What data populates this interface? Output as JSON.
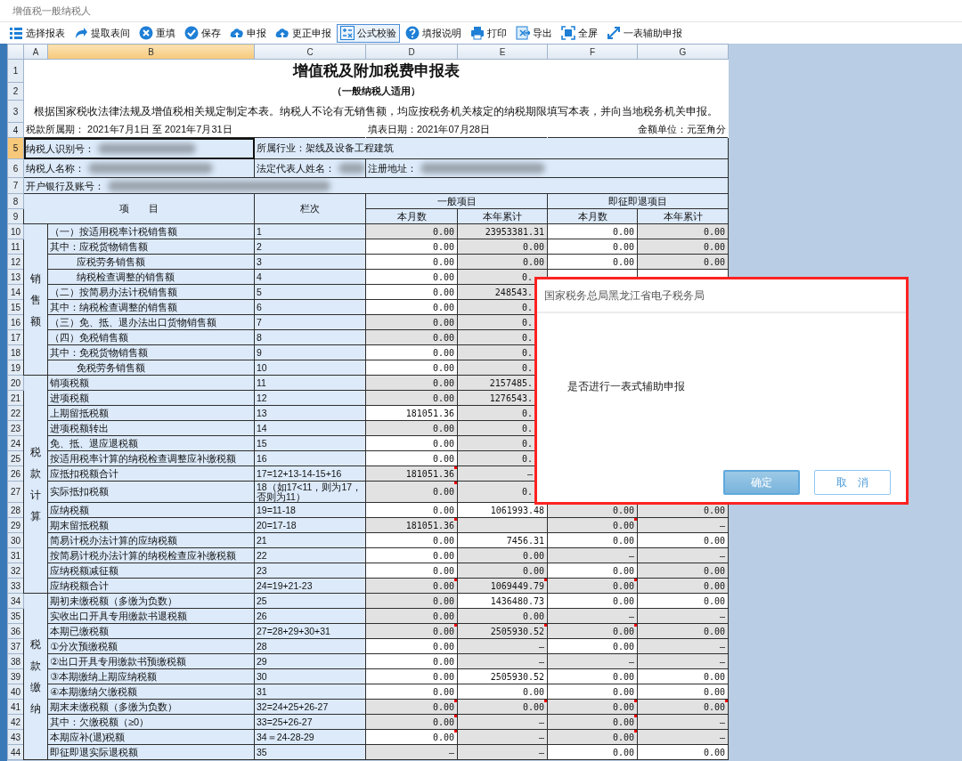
{
  "window": {
    "title": "增值税一般纳税人"
  },
  "toolbar": [
    {
      "label": "选择报表",
      "selected": false
    },
    {
      "label": "提取表间",
      "selected": false
    },
    {
      "label": "重填",
      "selected": false
    },
    {
      "label": "保存",
      "selected": false
    },
    {
      "label": "申报",
      "selected": false
    },
    {
      "label": "更正申报",
      "selected": false
    },
    {
      "label": "公式校验",
      "selected": true
    },
    {
      "label": "填报说明",
      "selected": false
    },
    {
      "label": "打印",
      "selected": false
    },
    {
      "label": "导出",
      "selected": false
    },
    {
      "label": "全屏",
      "selected": false
    },
    {
      "label": "一表辅助申报",
      "selected": false
    }
  ],
  "columns": [
    {
      "label": "A",
      "selected": false
    },
    {
      "label": "B",
      "selected": true
    },
    {
      "label": "C",
      "selected": false
    },
    {
      "label": "D",
      "selected": false
    },
    {
      "label": "E",
      "selected": false
    },
    {
      "label": "F",
      "selected": false
    },
    {
      "label": "G",
      "selected": false
    }
  ],
  "header_rows": [
    {
      "number": "1",
      "selected": false
    },
    {
      "number": "2",
      "selected": false
    },
    {
      "number": "3",
      "selected": false
    },
    {
      "number": "4",
      "selected": false
    },
    {
      "number": "5",
      "selected": true
    },
    {
      "number": "6",
      "selected": false
    },
    {
      "number": "7",
      "selected": false
    },
    {
      "number": "8",
      "selected": false
    },
    {
      "number": "9",
      "selected": false
    }
  ],
  "form": {
    "title": "增值税及附加税费申报表",
    "subtitle": "（一般纳税人适用）",
    "note": "根据国家税收法律法规及增值税相关规定制定本表。纳税人不论有无销售额，均应按税务机关核定的纳税期限填写本表，并向当地税务机关申报。",
    "period": "税款所属期：  2021年7月1日 至 2021年7月31日",
    "fill_date": "填表日期：2021年07月28日",
    "unit": "金额单位：元至角分",
    "taxpayer_id": {
      "label": "纳税人识别号：",
      "redacted": true
    },
    "industry": "所属行业：架线及设备工程建筑",
    "taxpayer_name": {
      "label": "纳税人名称：",
      "redacted": true
    },
    "legal_rep": {
      "label": "法定代表人姓名：",
      "redacted": true
    },
    "address": {
      "label": "注册地址：",
      "redacted": true
    },
    "bank_account": {
      "label": "开户银行及账号：",
      "redacted": true
    },
    "head": {
      "item": "项　　目",
      "line": "栏次",
      "general": "一般项目",
      "immediate": "即征即退项目",
      "sub": [
        "本月数",
        "本年累计",
        "本月数",
        "本年累计"
      ]
    }
  },
  "groups": [
    {
      "label": "销售额",
      "rows": [
        {
          "number": "10",
          "item": "（一）按适用税率计税销售额",
          "indented": false,
          "line": "1",
          "cells": [
            {
              "v": "0.00",
              "editable": false,
              "flagged": false
            },
            {
              "v": "23953381.31",
              "editable": false,
              "flagged": false
            },
            {
              "v": "0.00",
              "editable": true,
              "flagged": false
            },
            {
              "v": "0.00",
              "editable": false,
              "flagged": false
            }
          ]
        },
        {
          "number": "11",
          "item": "其中：应税货物销售额",
          "indented": false,
          "line": "2",
          "cells": [
            {
              "v": "0.00",
              "editable": true,
              "flagged": false
            },
            {
              "v": "0.00",
              "editable": false,
              "flagged": false
            },
            {
              "v": "0.00",
              "editable": true,
              "flagged": false
            },
            {
              "v": "0.00",
              "editable": false,
              "flagged": false
            }
          ]
        },
        {
          "number": "12",
          "item": "应税劳务销售额",
          "indented": true,
          "line": "3",
          "cells": [
            {
              "v": "0.00",
              "editable": true,
              "flagged": false
            },
            {
              "v": "0.00",
              "editable": false,
              "flagged": false
            },
            {
              "v": "0.00",
              "editable": true,
              "flagged": false
            },
            {
              "v": "0.00",
              "editable": false,
              "flagged": false
            }
          ]
        },
        {
          "number": "13",
          "item": "纳税检查调整的销售额",
          "indented": true,
          "line": "4",
          "cells": [
            {
              "v": "0.00",
              "editable": true,
              "flagged": false
            },
            {
              "v": "0.",
              "editable": false
            }
          ]
        },
        {
          "number": "14",
          "item": "（二）按简易办法计税销售额",
          "indented": false,
          "line": "5",
          "cells": [
            {
              "v": "0.00",
              "editable": true,
              "flagged": false
            },
            {
              "v": "248543.",
              "editable": false
            }
          ]
        },
        {
          "number": "15",
          "item": "其中：纳税检查调整的销售额",
          "indented": false,
          "line": "6",
          "cells": [
            {
              "v": "0.00",
              "editable": true,
              "flagged": false
            },
            {
              "v": "0.",
              "editable": false
            }
          ]
        },
        {
          "number": "16",
          "item": "（三）免、抵、退办法出口货物销售额",
          "indented": false,
          "line": "7",
          "cells": [
            {
              "v": "0.00",
              "editable": false,
              "flagged": false
            },
            {
              "v": "0.",
              "editable": false
            }
          ]
        },
        {
          "number": "17",
          "item": "（四）免税销售额",
          "indented": false,
          "line": "8",
          "cells": [
            {
              "v": "0.00",
              "editable": false,
              "flagged": false
            },
            {
              "v": "0.",
              "editable": false
            }
          ]
        },
        {
          "number": "18",
          "item": "其中：免税货物销售额",
          "indented": false,
          "line": "9",
          "cells": [
            {
              "v": "0.00",
              "editable": true,
              "flagged": false
            },
            {
              "v": "0.",
              "editable": false
            }
          ]
        },
        {
          "number": "19",
          "item": "免税劳务销售额",
          "indented": true,
          "line": "10",
          "cells": [
            {
              "v": "0.00",
              "editable": true,
              "flagged": false
            },
            {
              "v": "0.",
              "editable": false
            }
          ]
        }
      ]
    },
    {
      "label": "税款计算",
      "rows": [
        {
          "number": "20",
          "item": "销项税额",
          "indented": false,
          "line": "11",
          "cells": [
            {
              "v": "0.00",
              "editable": false,
              "flagged": false
            },
            {
              "v": "2157485.",
              "editable": false
            }
          ]
        },
        {
          "number": "21",
          "item": "进项税额",
          "indented": false,
          "line": "12",
          "cells": [
            {
              "v": "0.00",
              "editable": false,
              "flagged": false
            },
            {
              "v": "1276543.",
              "editable": false
            }
          ]
        },
        {
          "number": "22",
          "item": "上期留抵税额",
          "indented": false,
          "line": "13",
          "cells": [
            {
              "v": "181051.36",
              "editable": true,
              "flagged": false
            },
            {
              "v": "0.",
              "editable": false
            }
          ]
        },
        {
          "number": "23",
          "item": "进项税额转出",
          "indented": false,
          "line": "14",
          "cells": [
            {
              "v": "0.00",
              "editable": false,
              "flagged": false
            },
            {
              "v": "0.",
              "editable": false
            }
          ]
        },
        {
          "number": "24",
          "item": "免、抵、退应退税额",
          "indented": false,
          "line": "15",
          "cells": [
            {
              "v": "0.00",
              "editable": true,
              "flagged": false
            },
            {
              "v": "0.",
              "editable": false
            }
          ]
        },
        {
          "number": "25",
          "item": "按适用税率计算的纳税检查调整应补缴税额",
          "indented": false,
          "line": "16",
          "cells": [
            {
              "v": "0.00",
              "editable": true,
              "flagged": false
            },
            {
              "v": "0.",
              "editable": false
            }
          ]
        },
        {
          "number": "26",
          "item": "应抵扣税额合计",
          "indented": false,
          "line": "17=12+13-14-15+16",
          "cells": [
            {
              "v": "181051.36",
              "editable": false,
              "flagged": true
            },
            {
              "v": "—",
              "editable": false
            }
          ]
        },
        {
          "number": "27",
          "item": "实际抵扣税额",
          "indented": false,
          "line": "18（如17<11，则为17，否则为11）",
          "cells": [
            {
              "v": "0.00",
              "editable": false,
              "flagged": true
            },
            {
              "v": "0.",
              "editable": false
            }
          ]
        },
        {
          "number": "28",
          "item": "应纳税额",
          "indented": false,
          "line": "19=11-18",
          "cells": [
            {
              "v": "0.00",
              "editable": true,
              "flagged": false
            },
            {
              "v": "1061993.48",
              "editable": true,
              "flagged": false
            },
            {
              "v": "0.00",
              "editable": false,
              "flagged": false
            },
            {
              "v": "0.00",
              "editable": false,
              "flagged": false
            }
          ]
        },
        {
          "number": "29",
          "item": "期末留抵税额",
          "indented": false,
          "line": "20=17-18",
          "cells": [
            {
              "v": "181051.36",
              "editable": false,
              "flagged": true
            },
            {
              "editable": false,
              "flagged": false
            },
            {
              "v": "0.00",
              "editable": false,
              "flagged": true
            },
            {
              "v": "—",
              "editable": false,
              "flagged": false
            }
          ]
        },
        {
          "number": "30",
          "item": "简易计税办法计算的应纳税额",
          "indented": false,
          "line": "21",
          "cells": [
            {
              "v": "0.00",
              "editable": true,
              "flagged": false
            },
            {
              "v": "7456.31",
              "editable": true,
              "flagged": false
            },
            {
              "v": "0.00",
              "editable": true,
              "flagged": false
            },
            {
              "v": "0.00",
              "editable": true,
              "flagged": false
            }
          ]
        },
        {
          "number": "31",
          "item": "按简易计税办法计算的纳税检查应补缴税额",
          "indented": false,
          "line": "22",
          "cells": [
            {
              "v": "0.00",
              "editable": true,
              "flagged": false
            },
            {
              "v": "0.00",
              "editable": false,
              "flagged": false
            },
            {
              "v": "—",
              "editable": false,
              "flagged": false
            },
            {
              "v": "—",
              "editable": false,
              "flagged": false
            }
          ]
        },
        {
          "number": "32",
          "item": "应纳税额减征额",
          "indented": false,
          "line": "23",
          "cells": [
            {
              "v": "0.00",
              "editable": true,
              "flagged": false
            },
            {
              "v": "0.00",
              "editable": false,
              "flagged": false
            },
            {
              "v": "0.00",
              "editable": true,
              "flagged": false
            },
            {
              "v": "0.00",
              "editable": false,
              "flagged": false
            }
          ]
        },
        {
          "number": "33",
          "item": "应纳税额合计",
          "indented": false,
          "line": "24=19+21-23",
          "cells": [
            {
              "v": "0.00",
              "editable": false,
              "flagged": true
            },
            {
              "v": "1069449.79",
              "editable": false,
              "flagged": true
            },
            {
              "v": "0.00",
              "editable": false,
              "flagged": true
            },
            {
              "v": "0.00",
              "editable": false,
              "flagged": false
            }
          ]
        }
      ]
    },
    {
      "label": "税款缴纳",
      "rows": [
        {
          "number": "34",
          "item": "期初未缴税额（多缴为负数）",
          "indented": false,
          "line": "25",
          "cells": [
            {
              "v": "0.00",
              "editable": false,
              "flagged": false
            },
            {
              "v": "1436480.73",
              "editable": true,
              "flagged": false
            },
            {
              "v": "0.00",
              "editable": true,
              "flagged": false
            },
            {
              "v": "0.00",
              "editable": true,
              "flagged": false
            }
          ]
        },
        {
          "number": "35",
          "item": "实收出口开具专用缴款书退税额",
          "indented": false,
          "line": "26",
          "cells": [
            {
              "v": "0.00",
              "editable": false,
              "flagged": false
            },
            {
              "v": "0.00",
              "editable": false,
              "flagged": false
            },
            {
              "v": "—",
              "editable": false,
              "flagged": false
            },
            {
              "v": "—",
              "editable": false,
              "flagged": false
            }
          ]
        },
        {
          "number": "36",
          "item": "本期已缴税额",
          "indented": false,
          "line": "27=28+29+30+31",
          "cells": [
            {
              "v": "0.00",
              "editable": false,
              "flagged": true
            },
            {
              "v": "2505930.52",
              "editable": false,
              "flagged": true
            },
            {
              "v": "0.00",
              "editable": false,
              "flagged": true
            },
            {
              "v": "0.00",
              "editable": false,
              "flagged": false
            }
          ]
        },
        {
          "number": "37",
          "item": "①分次预缴税额",
          "indented": false,
          "line": "28",
          "cells": [
            {
              "v": "0.00",
              "editable": true,
              "flagged": false
            },
            {
              "v": "—",
              "editable": false,
              "flagged": false
            },
            {
              "v": "0.00",
              "editable": true,
              "flagged": false
            },
            {
              "v": "—",
              "editable": false,
              "flagged": false
            }
          ]
        },
        {
          "number": "38",
          "item": "②出口开具专用缴款书预缴税额",
          "indented": false,
          "line": "29",
          "cells": [
            {
              "v": "0.00",
              "editable": true,
              "flagged": false
            },
            {
              "v": "—",
              "editable": false,
              "flagged": false
            },
            {
              "v": "—",
              "editable": false,
              "flagged": false
            },
            {
              "v": "—",
              "editable": false,
              "flagged": false
            }
          ]
        },
        {
          "number": "39",
          "item": "③本期缴纳上期应纳税额",
          "indented": false,
          "line": "30",
          "cells": [
            {
              "v": "0.00",
              "editable": true,
              "flagged": false
            },
            {
              "v": "2505930.52",
              "editable": true,
              "flagged": false
            },
            {
              "v": "0.00",
              "editable": true,
              "flagged": false
            },
            {
              "v": "0.00",
              "editable": true,
              "flagged": false
            }
          ]
        },
        {
          "number": "40",
          "item": "④本期缴纳欠缴税额",
          "indented": false,
          "line": "31",
          "cells": [
            {
              "v": "0.00",
              "editable": true,
              "flagged": false
            },
            {
              "v": "0.00",
              "editable": true,
              "flagged": false
            },
            {
              "v": "0.00",
              "editable": true,
              "flagged": false
            },
            {
              "v": "0.00",
              "editable": true,
              "flagged": false
            }
          ]
        },
        {
          "number": "41",
          "item": "期末未缴税额（多缴为负数）",
          "indented": false,
          "line": "32=24+25+26-27",
          "cells": [
            {
              "v": "0.00",
              "editable": false,
              "flagged": true
            },
            {
              "v": "0.00",
              "editable": false,
              "flagged": true
            },
            {
              "v": "0.00",
              "editable": false,
              "flagged": true
            },
            {
              "v": "0.00",
              "editable": false,
              "flagged": true
            }
          ]
        },
        {
          "number": "42",
          "item": "其中：欠缴税额（≥0）",
          "indented": false,
          "line": "33=25+26-27",
          "cells": [
            {
              "v": "0.00",
              "editable": false,
              "flagged": true
            },
            {
              "v": "—",
              "editable": false,
              "flagged": false
            },
            {
              "v": "0.00",
              "editable": false,
              "flagged": true
            },
            {
              "v": "—",
              "editable": false,
              "flagged": false
            }
          ]
        },
        {
          "number": "43",
          "item": "本期应补(退)税额",
          "indented": false,
          "line": "34＝24-28-29",
          "cells": [
            {
              "v": "0.00",
              "editable": true,
              "flagged": true
            },
            {
              "v": "—",
              "editable": false,
              "flagged": false
            },
            {
              "v": "0.00",
              "editable": false,
              "flagged": true
            },
            {
              "v": "—",
              "editable": false,
              "flagged": false
            }
          ]
        },
        {
          "number": "44",
          "item": "即征即退实际退税额",
          "indented": false,
          "line": "35",
          "cells": [
            {
              "v": "—",
              "editable": false,
              "flagged": false
            },
            {
              "v": "—",
              "editable": false,
              "flagged": false
            },
            {
              "v": "0.00",
              "editable": true,
              "flagged": false
            },
            {
              "v": "0.00",
              "editable": true,
              "flagged": false
            }
          ]
        }
      ]
    }
  ],
  "dialog": {
    "title": "国家税务总局黑龙江省电子税务局",
    "message": "是否进行一表式辅助申报",
    "buttons": [
      {
        "label": "确定",
        "kind": "primary"
      },
      {
        "label": "取　消",
        "kind": "secondary"
      }
    ]
  }
}
